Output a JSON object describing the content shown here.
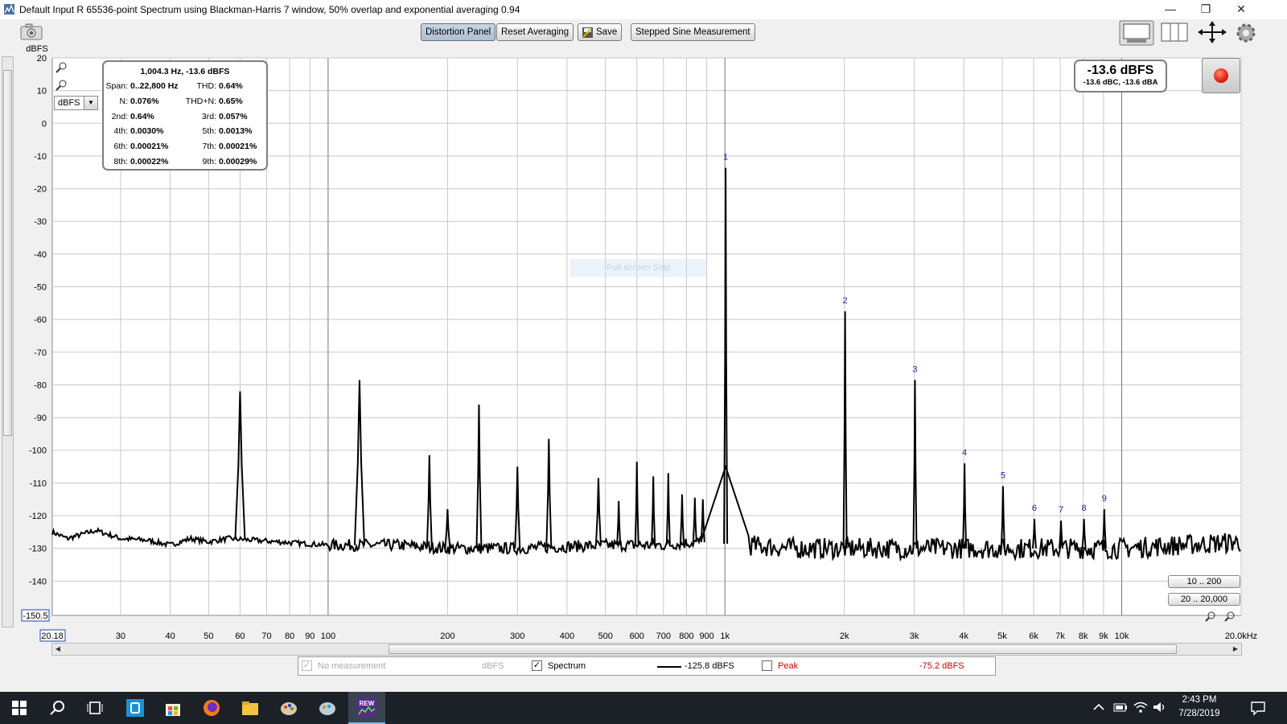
{
  "window": {
    "title": "Default Input R 65536-point Spectrum using Blackman-Harris 7 window, 50% overlap and exponential averaging 0.94",
    "minimize": "—",
    "restore": "❐",
    "close": "✕"
  },
  "toolbar": {
    "distortion_panel": "Distortion Panel",
    "reset_averaging": "Reset Averaging",
    "save": "Save",
    "stepped_sine": "Stepped Sine Measurement"
  },
  "y_axis_unit": "dBFS",
  "unit_select": "dBFS",
  "snip_watermark": "Full-screen Snip",
  "info": {
    "header": "1,004.3 Hz, -13.6 dBFS",
    "rows": [
      {
        "l1": "Span:",
        "v1": "0..22,800 Hz",
        "l2": "THD:",
        "v2": "0.64%"
      },
      {
        "l1": "N:",
        "v1": "0.076%",
        "l2": "THD+N:",
        "v2": "0.65%"
      },
      {
        "l1": "2nd:",
        "v1": "0.64%",
        "l2": "3rd:",
        "v2": "0.057%"
      },
      {
        "l1": "4th:",
        "v1": "0.0030%",
        "l2": "5th:",
        "v2": "0.0013%"
      },
      {
        "l1": "6th:",
        "v1": "0.00021%",
        "l2": "7th:",
        "v2": "0.00021%"
      },
      {
        "l1": "8th:",
        "v1": "0.00022%",
        "l2": "9th:",
        "v2": "0.00029%"
      }
    ]
  },
  "level": {
    "main": "-13.6 dBFS",
    "sub": "-13.6 dBC, -13.6 dBA"
  },
  "range_buttons": [
    "10 .. 200",
    "20 .. 20,000"
  ],
  "legend": {
    "no_measurement": "No measurement",
    "no_measurement_unit": "dBFS",
    "spectrum": "Spectrum",
    "spectrum_value": "-125.8 dBFS",
    "peak": "Peak",
    "peak_value": "-75.2 dBFS"
  },
  "taskbar": {
    "time": "2:43 PM",
    "date": "7/28/2019"
  },
  "chart_data": {
    "type": "line",
    "xscale": "log",
    "xlim": [
      20.18,
      20000
    ],
    "ylim": [
      -150.5,
      20
    ],
    "ylabel": "dBFS",
    "x_min_label": "20.18",
    "y_min_label": "-150.5",
    "yticks": [
      20,
      10,
      0,
      -10,
      -20,
      -30,
      -40,
      -50,
      -60,
      -70,
      -80,
      -90,
      -100,
      -110,
      -120,
      -130,
      -140
    ],
    "xticks": [
      {
        "v": 30,
        "t": "30"
      },
      {
        "v": 40,
        "t": "40"
      },
      {
        "v": 50,
        "t": "50"
      },
      {
        "v": 60,
        "t": "60"
      },
      {
        "v": 70,
        "t": "70"
      },
      {
        "v": 80,
        "t": "80"
      },
      {
        "v": 90,
        "t": "90"
      },
      {
        "v": 100,
        "t": "100"
      },
      {
        "v": 200,
        "t": "200"
      },
      {
        "v": 300,
        "t": "300"
      },
      {
        "v": 400,
        "t": "400"
      },
      {
        "v": 500,
        "t": "500"
      },
      {
        "v": 600,
        "t": "600"
      },
      {
        "v": 700,
        "t": "700"
      },
      {
        "v": 800,
        "t": "800"
      },
      {
        "v": 900,
        "t": "900"
      },
      {
        "v": 1000,
        "t": "1k"
      },
      {
        "v": 2000,
        "t": "2k"
      },
      {
        "v": 3000,
        "t": "3k"
      },
      {
        "v": 4000,
        "t": "4k"
      },
      {
        "v": 5000,
        "t": "5k"
      },
      {
        "v": 6000,
        "t": "6k"
      },
      {
        "v": 7000,
        "t": "7k"
      },
      {
        "v": 8000,
        "t": "8k"
      },
      {
        "v": 9000,
        "t": "9k"
      },
      {
        "v": 10000,
        "t": "10k"
      },
      {
        "v": 20000,
        "t": "20.0kHz"
      }
    ],
    "series": [
      {
        "name": "Spectrum",
        "color": "#000000",
        "floor": [
          [
            20.18,
            -125
          ],
          [
            22,
            -127
          ],
          [
            26,
            -124.5
          ],
          [
            30,
            -127
          ],
          [
            35,
            -127.5
          ],
          [
            40,
            -129
          ],
          [
            45,
            -127
          ],
          [
            50,
            -128
          ],
          [
            56,
            -127
          ],
          [
            100,
            -129
          ],
          [
            150,
            -129
          ],
          [
            200,
            -130
          ],
          [
            300,
            -130
          ],
          [
            500,
            -129
          ],
          [
            700,
            -129
          ],
          [
            850,
            -128
          ],
          [
            1500,
            -130
          ],
          [
            3000,
            -130
          ],
          [
            6000,
            -130
          ],
          [
            10000,
            -130
          ],
          [
            20000,
            -128
          ]
        ],
        "peaks": [
          {
            "f": 60,
            "a": -82
          },
          {
            "f": 120,
            "a": -78.5
          },
          {
            "f": 180,
            "a": -101.5
          },
          {
            "f": 200,
            "a": -118
          },
          {
            "f": 240,
            "a": -86
          },
          {
            "f": 300,
            "a": -105
          },
          {
            "f": 360,
            "a": -96.5
          },
          {
            "f": 480,
            "a": -108.5
          },
          {
            "f": 540,
            "a": -115.5
          },
          {
            "f": 600,
            "a": -103.5
          },
          {
            "f": 660,
            "a": -108
          },
          {
            "f": 720,
            "a": -107
          },
          {
            "f": 780,
            "a": -113.5
          },
          {
            "f": 840,
            "a": -114.5
          },
          {
            "f": 880,
            "a": -115
          },
          {
            "f": 1004.3,
            "a": -13.6
          },
          {
            "f": 2008.6,
            "a": -57.5
          },
          {
            "f": 3012.9,
            "a": -78.5
          },
          {
            "f": 4017.2,
            "a": -104
          },
          {
            "f": 5021.5,
            "a": -111
          },
          {
            "f": 6025.8,
            "a": -121
          },
          {
            "f": 7030.1,
            "a": -121.5
          },
          {
            "f": 8034.4,
            "a": -121
          },
          {
            "f": 9038.7,
            "a": -118
          }
        ],
        "harmonic_labels": [
          "1",
          "2",
          "3",
          "4",
          "5",
          "6",
          "7",
          "8",
          "9"
        ]
      }
    ]
  }
}
